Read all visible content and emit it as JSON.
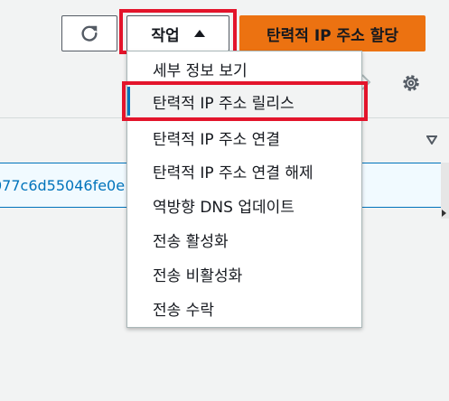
{
  "toolbar": {
    "refresh_icon": "refresh-icon",
    "actions_label": "작업",
    "allocate_label": "탄력적 IP 주소 할당",
    "allocate_color": "#ec7211",
    "highlight_color": "#e3142b"
  },
  "table": {
    "selected_row_text": "077c6d55046fe0e"
  },
  "menu": {
    "items": [
      {
        "label": "세부 정보 보기"
      },
      {
        "label": "탄력적 IP 주소 릴리스"
      },
      {
        "label": "탄력적 IP 주소 연결"
      },
      {
        "label": "탄력적 IP 주소 연결 해제"
      },
      {
        "label": "역방향 DNS 업데이트"
      },
      {
        "label": "전송 활성화"
      },
      {
        "label": "전송 비활성화"
      },
      {
        "label": "전송 수락"
      }
    ]
  }
}
